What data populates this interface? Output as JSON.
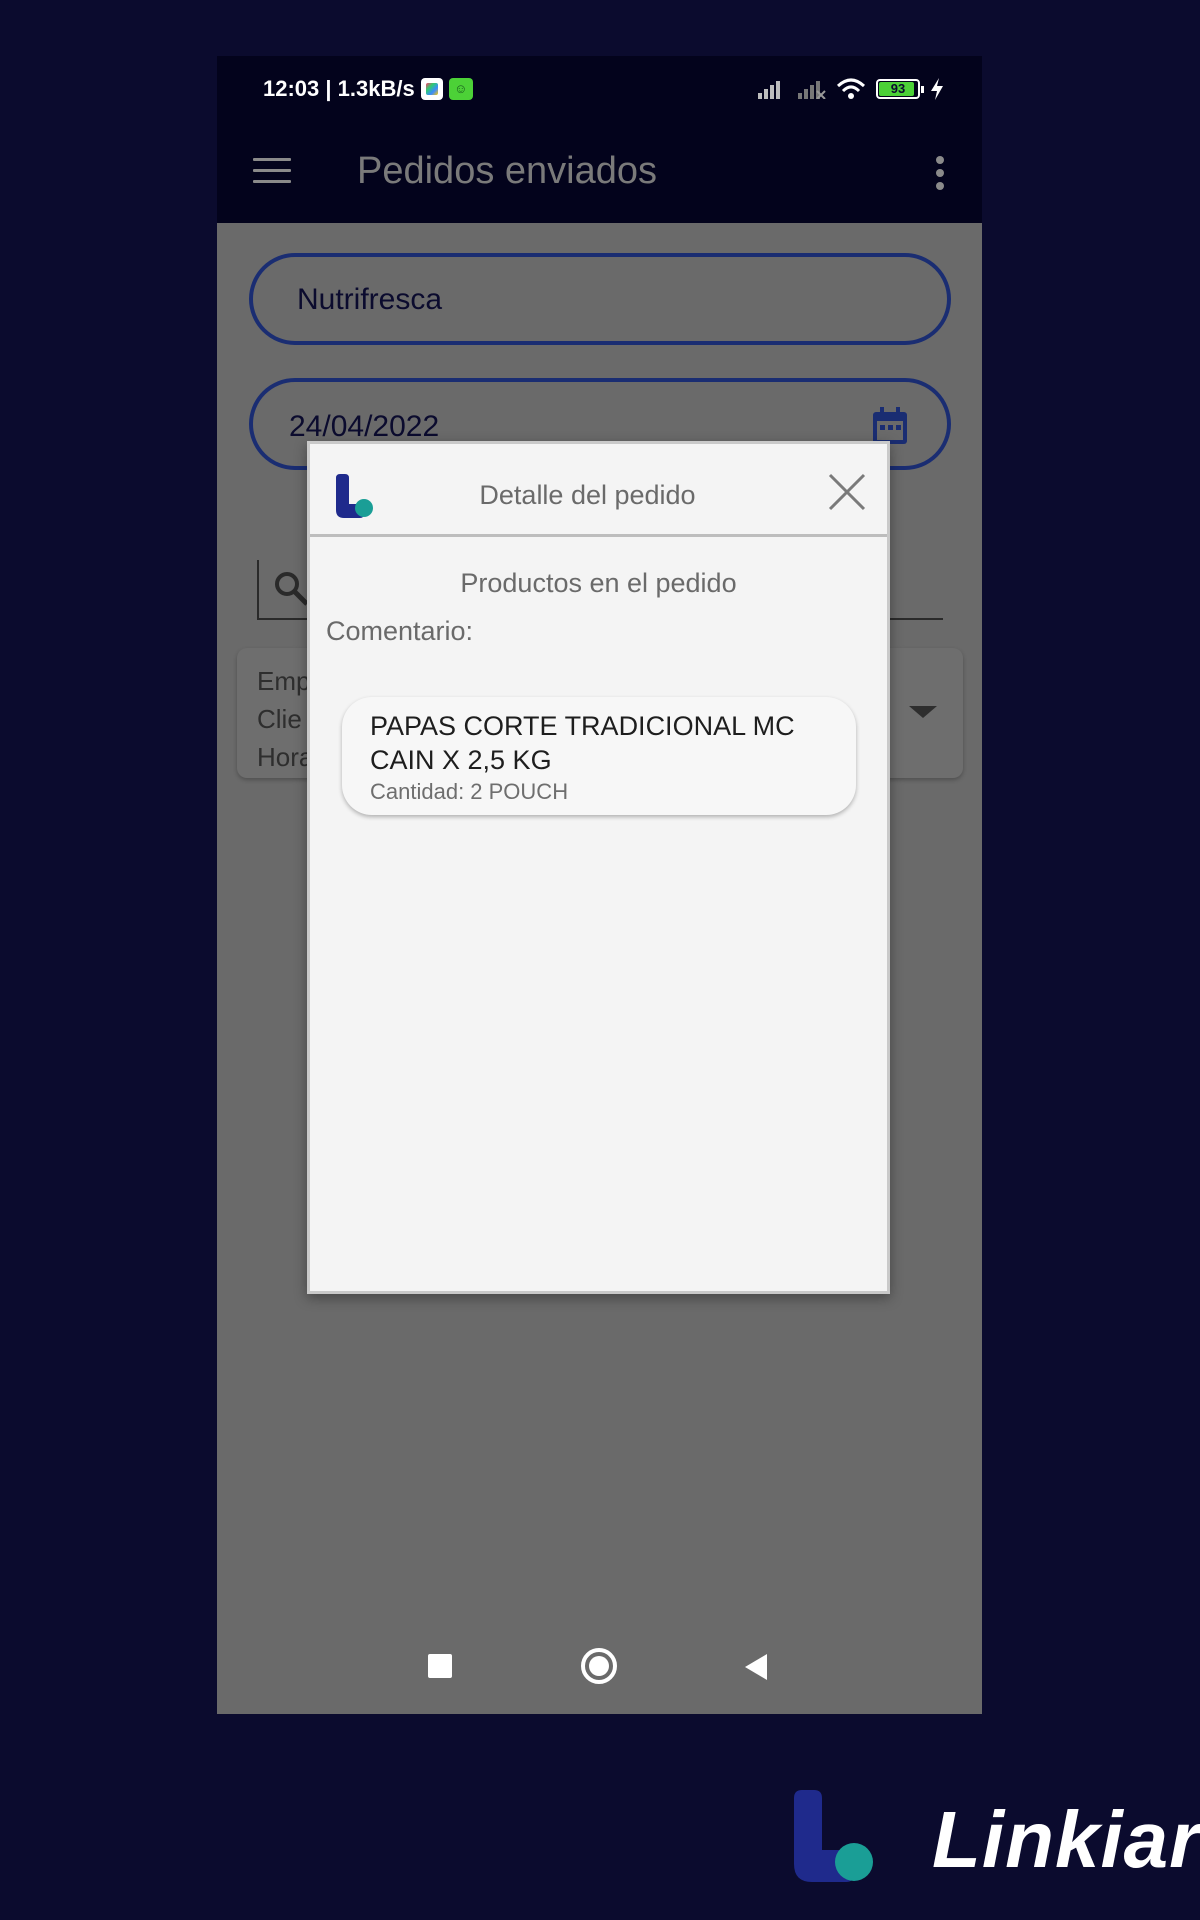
{
  "statusbar": {
    "time_speed": "12:03 | 1.3kB/s",
    "battery": "93"
  },
  "appbar": {
    "title": "Pedidos enviados"
  },
  "filters": {
    "company_value": "Nutrifresca",
    "date_value": "24/04/2022"
  },
  "order_card": {
    "line1": "Emp",
    "line2": "Clie",
    "line3": "Hora"
  },
  "dialog": {
    "title": "Detalle del pedido",
    "subtitle": "Productos en el pedido",
    "comment_label": "Comentario:",
    "products": [
      {
        "name": "PAPAS CORTE TRADICIONAL MC CAIN X 2,5 KG",
        "quantity": "Cantidad: 2 POUCH"
      }
    ]
  },
  "brand": {
    "name": "Linkiar"
  },
  "colors": {
    "page_background": "#0b0b2e",
    "appbar": "#03031c",
    "field_border": "#1a2d72",
    "logo_blue": "#1f2a8c",
    "logo_teal": "#1a9e96",
    "battery_fill": "#4cd137"
  },
  "icons": [
    "menu-icon",
    "more-vert-icon",
    "calendar-icon",
    "search-icon",
    "close-icon",
    "dropdown-arrow-icon",
    "recents-icon",
    "home-icon",
    "back-icon"
  ]
}
